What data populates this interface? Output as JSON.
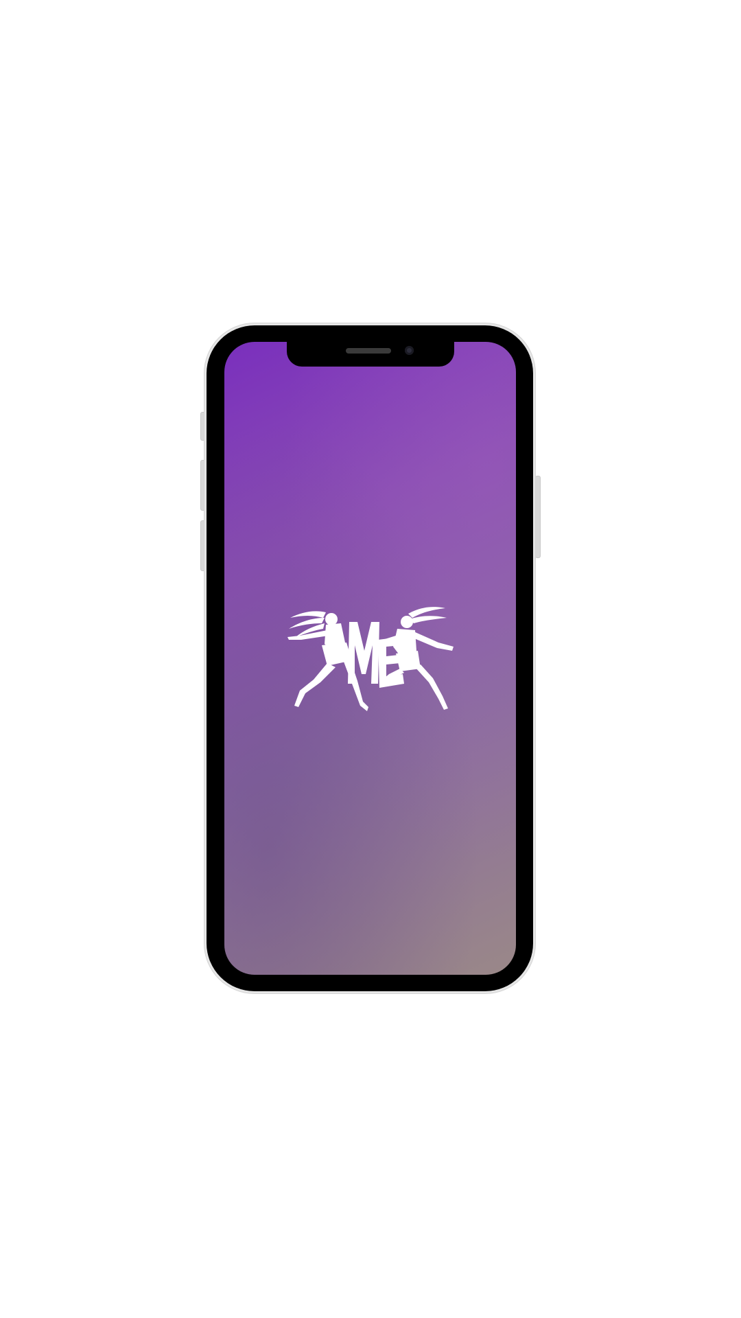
{
  "device": {
    "model": "phone-mockup",
    "frame_color": "#000000",
    "screen_gradient": [
      "#7a2fbd",
      "#8a4fb2",
      "#8a6aa0",
      "#9a8888"
    ]
  },
  "splash": {
    "logo_icon": "dancers-me-logo-icon",
    "logo_color": "#ffffff"
  }
}
